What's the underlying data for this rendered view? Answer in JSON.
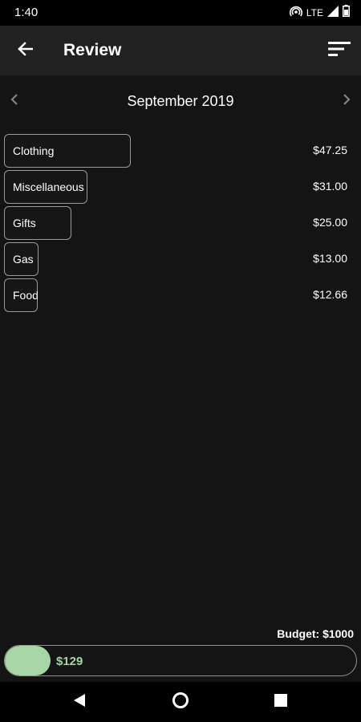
{
  "status_bar": {
    "time": "1:40",
    "network": "LTE",
    "icons": [
      "hotspot-icon",
      "signal-icon",
      "battery-icon"
    ]
  },
  "app_bar": {
    "title": "Review",
    "back_icon": "arrow-left-icon",
    "sort_icon": "sort-icon"
  },
  "month_nav": {
    "label": "September 2019",
    "prev_icon": "chevron-left-icon",
    "next_icon": "chevron-right-icon"
  },
  "categories": [
    {
      "name": "Clothing",
      "amount": "$47.25",
      "value": 47.25
    },
    {
      "name": "Miscellaneous",
      "amount": "$31.00",
      "value": 31.0
    },
    {
      "name": "Gifts",
      "amount": "$25.00",
      "value": 25.0
    },
    {
      "name": "Gas",
      "amount": "$13.00",
      "value": 13.0
    },
    {
      "name": "Food",
      "amount": "$12.66",
      "value": 12.66
    }
  ],
  "budget": {
    "label": "Budget: $1000",
    "spent": "$129",
    "spent_fraction": 0.129,
    "fill_color": "#a8d5a6"
  },
  "nav_bar": {
    "icons": [
      "back-triangle-icon",
      "home-circle-icon",
      "recents-square-icon"
    ]
  }
}
